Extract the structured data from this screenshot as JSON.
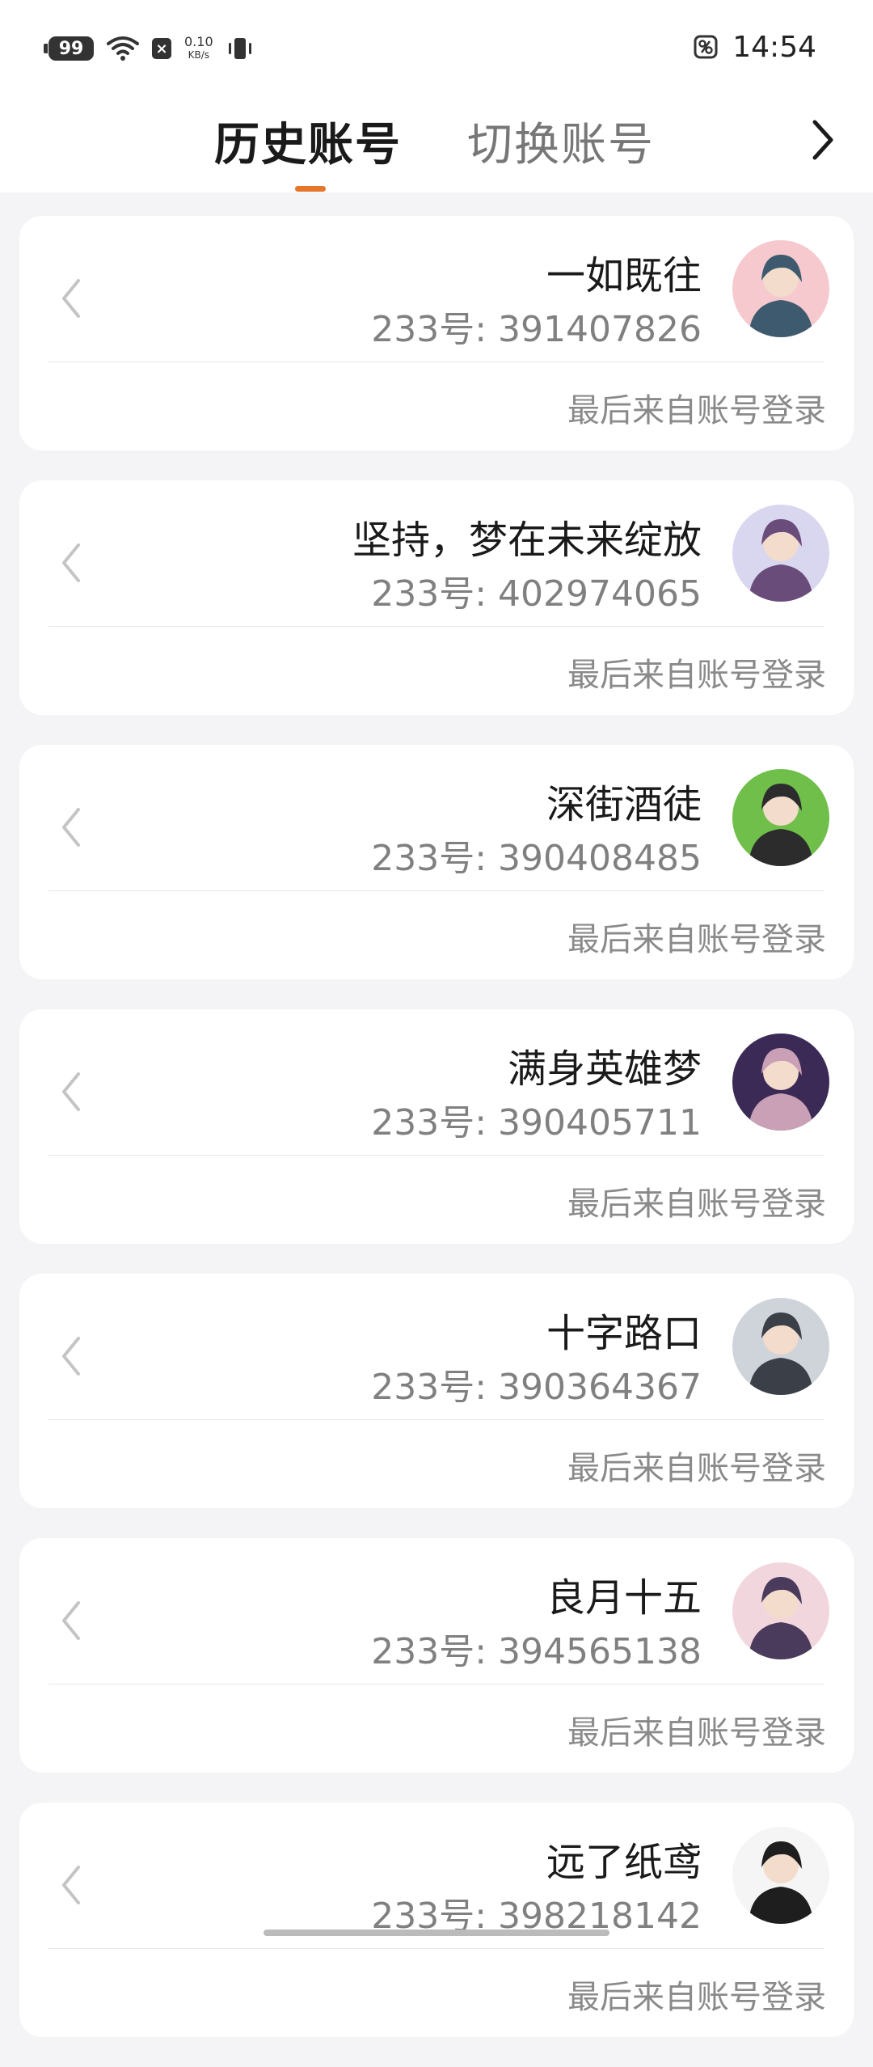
{
  "status_bar": {
    "battery": "99",
    "net_speed_value": "0.10",
    "net_speed_unit": "KB/s",
    "time": "14:54"
  },
  "header": {
    "tab_active": "历史账号",
    "tab_inactive": "切换账号"
  },
  "accounts": [
    {
      "name": "一如既往",
      "id": "233号: 391407826",
      "note": "最后来自账号登录",
      "avatar_colors": [
        "#f6c9cf",
        "#3d5a6e"
      ]
    },
    {
      "name": "坚持，梦在未来绽放",
      "id": "233号: 402974065",
      "note": "最后来自账号登录",
      "avatar_colors": [
        "#d9d6ef",
        "#6a4c7a"
      ]
    },
    {
      "name": "深街酒徒",
      "id": "233号: 390408485",
      "note": "最后来自账号登录",
      "avatar_colors": [
        "#6fbf4a",
        "#2c2c2c"
      ]
    },
    {
      "name": "满身英雄梦",
      "id": "233号: 390405711",
      "note": "最后来自账号登录",
      "avatar_colors": [
        "#3a2a55",
        "#c9a0b6"
      ]
    },
    {
      "name": "十字路口",
      "id": "233号: 390364367",
      "note": "最后来自账号登录",
      "avatar_colors": [
        "#cfd3da",
        "#3a3f48"
      ]
    },
    {
      "name": "良月十五",
      "id": "233号: 394565138",
      "note": "最后来自账号登录",
      "avatar_colors": [
        "#f2d6dd",
        "#4a3a5c"
      ]
    },
    {
      "name": "远了纸鸢",
      "id": "233号: 398218142",
      "note": "最后来自账号登录",
      "avatar_colors": [
        "#f5f5f5",
        "#1e1e1e"
      ]
    }
  ]
}
